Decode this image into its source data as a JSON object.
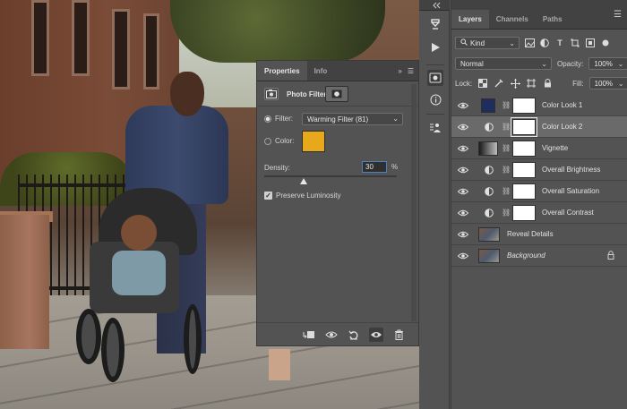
{
  "properties": {
    "tabs": [
      {
        "label": "Properties",
        "active": true
      },
      {
        "label": "Info",
        "active": false
      }
    ],
    "title": "Photo Filter",
    "filter_label": "Filter:",
    "filter_value": "Warming Filter (81)",
    "color_label": "Color:",
    "color_swatch": "#e8a81c",
    "density_label": "Density:",
    "density_value": "30",
    "density_unit": "%",
    "density_level": 0.3,
    "preserve_label": "Preserve Luminosity",
    "preserve_checked": true
  },
  "layers_panel": {
    "tabs": [
      {
        "label": "Layers",
        "active": true
      },
      {
        "label": "Channels",
        "active": false
      },
      {
        "label": "Paths",
        "active": false
      }
    ],
    "kind_value": "Kind",
    "blend_mode": "Normal",
    "opacity_label": "Opacity:",
    "opacity_value": "100%",
    "lock_label": "Lock:",
    "fill_label": "Fill:",
    "fill_value": "100%",
    "layers": [
      {
        "name": "Color Look 1",
        "thumb": "#1f2d5c",
        "type": "solid",
        "selected": false
      },
      {
        "name": "Color Look 2",
        "thumb": "adjustment",
        "type": "adjustment",
        "selected": true
      },
      {
        "name": "Vignette",
        "thumb": "gradient",
        "type": "gradient",
        "selected": false
      },
      {
        "name": "Overall Brightness",
        "thumb": "adjustment",
        "type": "adjustment",
        "selected": false
      },
      {
        "name": "Overall Saturation",
        "thumb": "adjustment",
        "type": "adjustment",
        "selected": false
      },
      {
        "name": "Overall Contrast",
        "thumb": "adjustment",
        "type": "adjustment",
        "selected": false
      },
      {
        "name": "Reveal Details",
        "thumb": "photo",
        "type": "photo",
        "selected": false
      },
      {
        "name": "Background",
        "thumb": "photo",
        "type": "photo",
        "selected": false,
        "locked": true
      }
    ]
  },
  "icons": {
    "eye": "eye-icon",
    "chain": "link-icon",
    "lock": "lock-icon",
    "adjustment": "adjustment-icon"
  }
}
